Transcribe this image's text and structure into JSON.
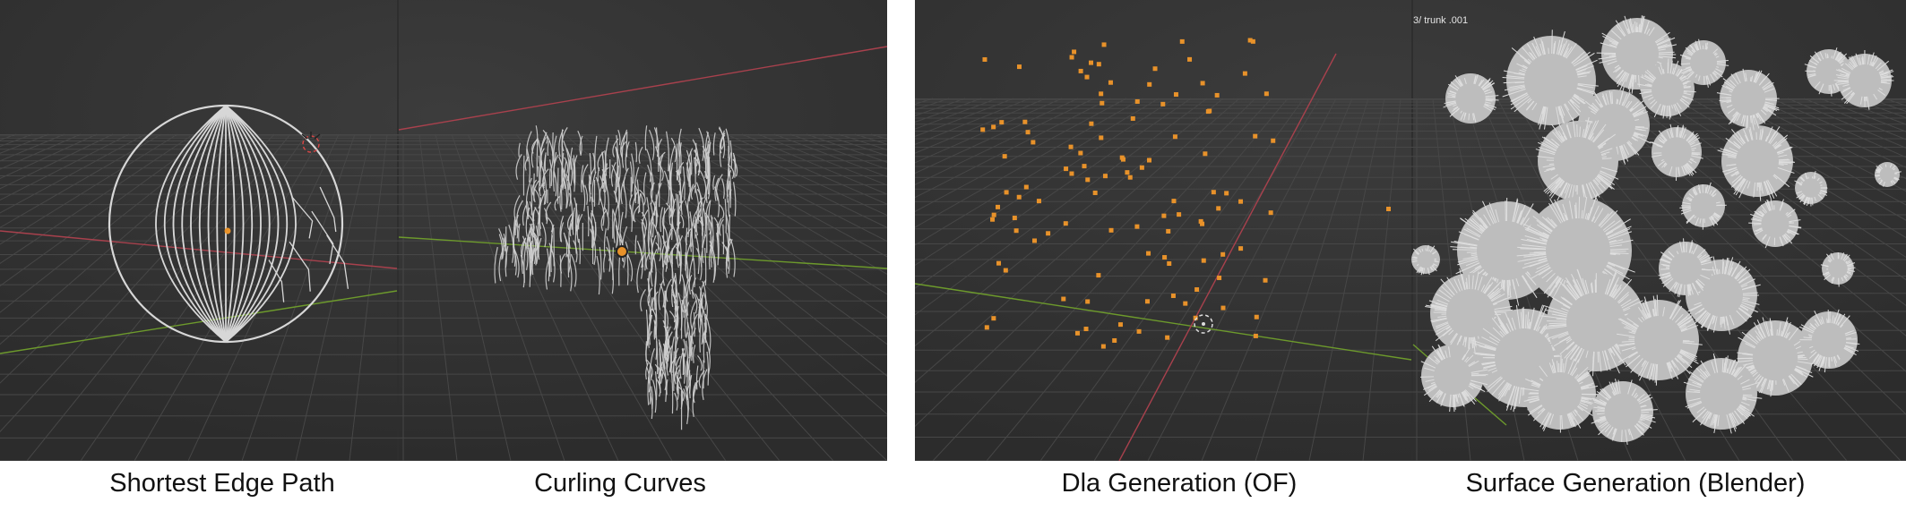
{
  "panels": [
    {
      "caption": "Shortest Edge Path"
    },
    {
      "caption": "Curling Curves"
    },
    {
      "caption": "Dla Generation (OF)"
    },
    {
      "caption": "Surface Generation (Blender)"
    }
  ],
  "viewport_overlay": {
    "object_label": "3/ trunk .001"
  },
  "colors": {
    "viewport_bg": "#3a3a3a",
    "grid_line": "#4a4a4a",
    "x_axis": "#a8414d",
    "y_axis": "#6d9a2c",
    "geometry": "#d7d7d7",
    "point": "#e8922a",
    "caption_text": "#111111"
  },
  "icons": [
    "origin-dot-icon",
    "3d-cursor-icon"
  ]
}
